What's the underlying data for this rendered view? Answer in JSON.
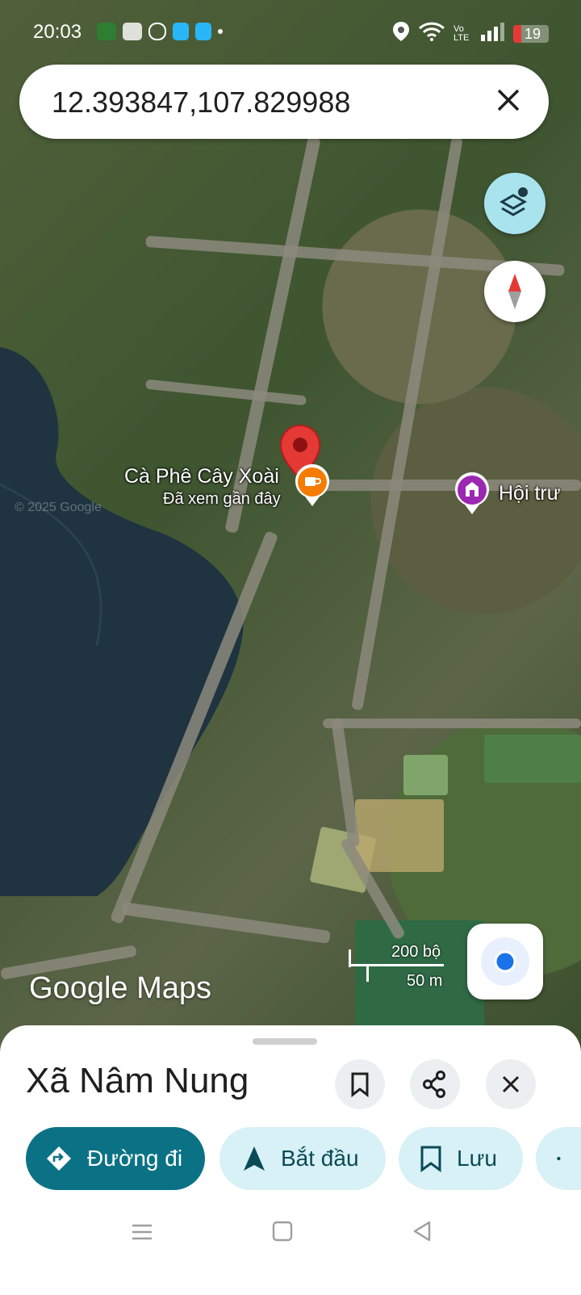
{
  "status_bar": {
    "time": "20:03",
    "battery": "19",
    "network": "Vo LTE"
  },
  "search": {
    "query": "12.393847,107.829988"
  },
  "map": {
    "pois": [
      {
        "name": "Cà Phê Cây Xoài",
        "subtitle": "Đã xem gần đây",
        "type": "cafe",
        "icon": "coffee-cup-icon",
        "color": "#f57c00"
      },
      {
        "name": "Hội trư",
        "type": "landmark",
        "icon": "building-icon",
        "color": "#9c27b0"
      }
    ],
    "copyright": "© 2025 Google",
    "logo": "Google Maps",
    "scale": {
      "imperial": "200 bộ",
      "metric": "50 m"
    }
  },
  "sheet": {
    "title": "Xã Nâm Nung",
    "actions": [
      {
        "label": "Đường đi",
        "icon": "directions-icon",
        "primary": true
      },
      {
        "label": "Bắt đầu",
        "icon": "navigation-arrow-icon"
      },
      {
        "label": "Lưu",
        "icon": "bookmark-icon"
      },
      {
        "label": "",
        "icon": "share-icon"
      }
    ]
  },
  "colors": {
    "accent": "#0b7285",
    "chip_bg": "#d7f1f6",
    "pin": "#e53935"
  }
}
